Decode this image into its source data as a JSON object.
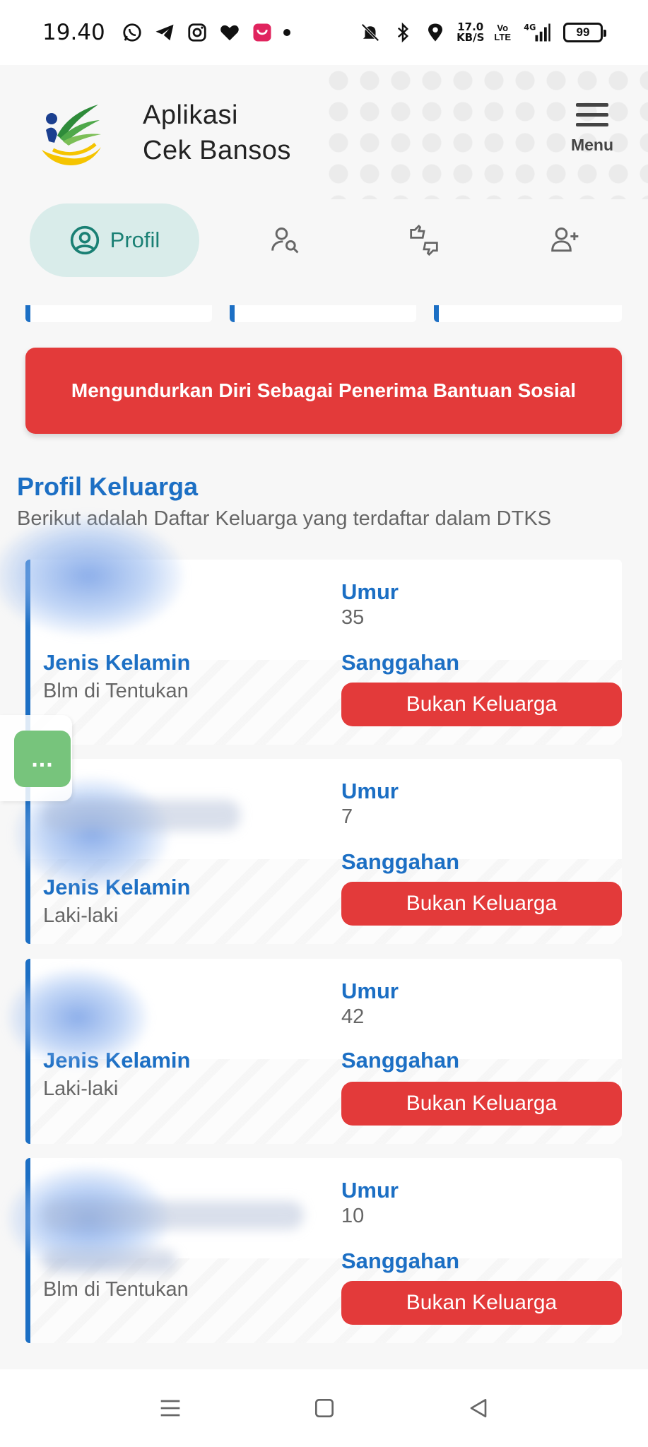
{
  "status_bar": {
    "time": "19.40",
    "net_speed_value": "17.0",
    "net_speed_unit": "KB/S",
    "volte_top": "Vo",
    "volte_bottom": "LTE",
    "signal_type": "4G",
    "battery": "99"
  },
  "header": {
    "title_line1": "Aplikasi",
    "title_line2": "Cek Bansos",
    "menu_label": "Menu"
  },
  "tabs": {
    "active_label": "Profil"
  },
  "resign_button_label": "Mengundurkan Diri Sebagai Penerima Bantuan Sosial",
  "section": {
    "title": "Profil Keluarga",
    "subtitle": "Berikut adalah Daftar Keluarga yang terdaftar dalam DTKS"
  },
  "labels": {
    "umur": "Umur",
    "jenis_kelamin": "Jenis Kelamin",
    "sanggahan": "Sanggahan",
    "bukan_keluarga": "Bukan Keluarga"
  },
  "family": [
    {
      "umur": "35",
      "jenis_kelamin": "Blm di Tentukan"
    },
    {
      "umur": "7",
      "jenis_kelamin": "Laki-laki"
    },
    {
      "umur": "42",
      "jenis_kelamin": "Laki-laki"
    },
    {
      "umur": "10",
      "jenis_kelamin": "Blm di Tentukan"
    }
  ],
  "chat_button_label": "...",
  "colors": {
    "accent_blue": "#1c6fc4",
    "danger_red": "#e33a3a",
    "tab_active_bg": "#d9ecea",
    "tab_active_text": "#1a8074",
    "chat_green": "#77c47c"
  }
}
